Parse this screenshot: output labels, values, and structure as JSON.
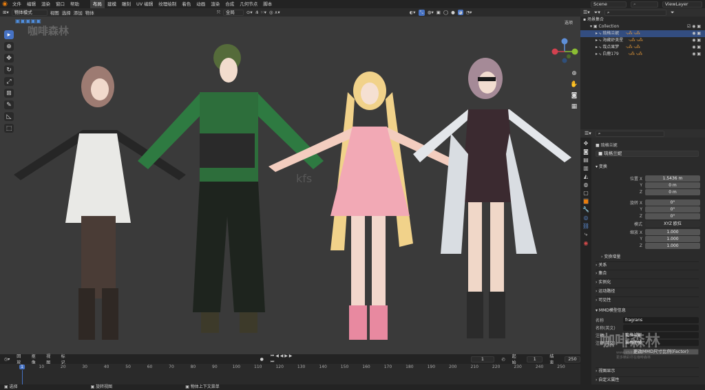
{
  "app": {
    "accent": "#e87d0d",
    "select_blue": "#4672c4"
  },
  "menu": [
    "文件",
    "编辑",
    "渲染",
    "窗口",
    "帮助"
  ],
  "workspaces": [
    "布局",
    "建模",
    "雕刻",
    "UV 编辑",
    "纹理绘制",
    "着色",
    "动画",
    "渲染",
    "合成",
    "几何节点",
    "脚本"
  ],
  "active_workspace": "布局",
  "scene_name": "Scene",
  "view_layer": "ViewLayer",
  "viewport": {
    "mode": "物体模式",
    "menus": [
      "视图",
      "选择",
      "添加",
      "物体"
    ],
    "transform_orientation": "全局",
    "options_label": "选项",
    "watermark": "咖啡森林",
    "watermark_small": "kfs"
  },
  "outliner": {
    "root": "场景集合",
    "collection": "Collection",
    "items": [
      "琉格兰妮",
      "海藏舒美星",
      "哉点果梦",
      "白鹿179"
    ],
    "selected_index": 0
  },
  "properties": {
    "search_placeholder": "",
    "object_path": "琉格兰妮",
    "object_name": "琉格兰妮",
    "transform_title": "变换",
    "location_label": "位置 X",
    "location": [
      "1.5436 m",
      "0 m",
      "0 m"
    ],
    "rotation_label": "旋转 X",
    "rotation": [
      "0°",
      "0°",
      "0°"
    ],
    "mode_label": "模式",
    "mode_value": "XYZ 欧拉",
    "scale_label": "缩放 X",
    "scale": [
      "1.000",
      "1.000",
      "1.000"
    ],
    "axis_y": "Y",
    "axis_z": "Z",
    "delta_label": "变换增量",
    "sections": [
      "关系",
      "集合",
      "实例化",
      "运动路径",
      "可见性"
    ],
    "mmd_section": "MMD模型信息",
    "mmd_name_label": "名称",
    "mmd_name": "fragrans",
    "mmd_name_en_label": "名称(英文)",
    "mmd_comment_label": "注释",
    "mmd_comment": "琉格兰妮",
    "mmd_comment_en_label": "注释(英文)",
    "mmd_comment_en": "琉格明帧",
    "mmd_button": "更改MMD尺寸比例(Factor)",
    "bottom_sections": [
      "视图显示",
      "自定义属性"
    ]
  },
  "timeline": {
    "menus": [
      "回放",
      "抠像",
      "视图",
      "标记"
    ],
    "current_frame": "1",
    "start_label": "起始",
    "start": "1",
    "end_label": "结束",
    "end": "250",
    "ticks": [
      "1",
      "10",
      "20",
      "30",
      "40",
      "50",
      "60",
      "70",
      "80",
      "90",
      "100",
      "110",
      "120",
      "130",
      "140",
      "150",
      "160",
      "170",
      "180",
      "190",
      "200",
      "210",
      "220",
      "230",
      "240",
      "250"
    ]
  },
  "status": {
    "select": "选择",
    "rotate": "旋转视图",
    "context": "物体上下文菜单"
  },
  "watermark_br": "咖啡森林",
  "watermark_br_url": "www.kfslin.com",
  "watermark_br_sub": "更多精彩尽在咖啡森林"
}
